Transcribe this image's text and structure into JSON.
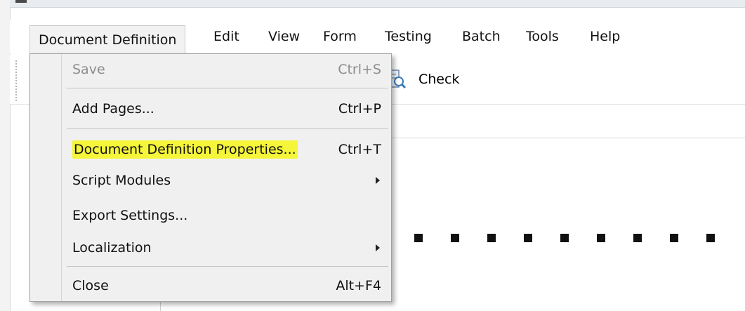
{
  "menubar": {
    "items": [
      "Document Definition",
      "Edit",
      "View",
      "Form",
      "Testing",
      "Batch",
      "Tools",
      "Help"
    ]
  },
  "toolbar": {
    "check_label": "Check"
  },
  "dropdown": {
    "items": [
      {
        "label": "Save",
        "shortcut": "Ctrl+S",
        "disabled": true
      },
      {
        "label": "Add Pages...",
        "shortcut": "Ctrl+P"
      },
      {
        "label": "Document Definition Properties...",
        "shortcut": "Ctrl+T",
        "highlighted": true,
        "highlight_color": "#f5f53a"
      },
      {
        "label": "Script Modules",
        "submenu": true
      },
      {
        "label": "Export Settings..."
      },
      {
        "label": "Localization",
        "submenu": true
      },
      {
        "label": "Close",
        "shortcut": "Alt+F4"
      }
    ]
  },
  "colors": {
    "menu_bg": "#f0f0f0",
    "highlight": "#f5f53a",
    "disabled_text": "#8d8d8d"
  }
}
